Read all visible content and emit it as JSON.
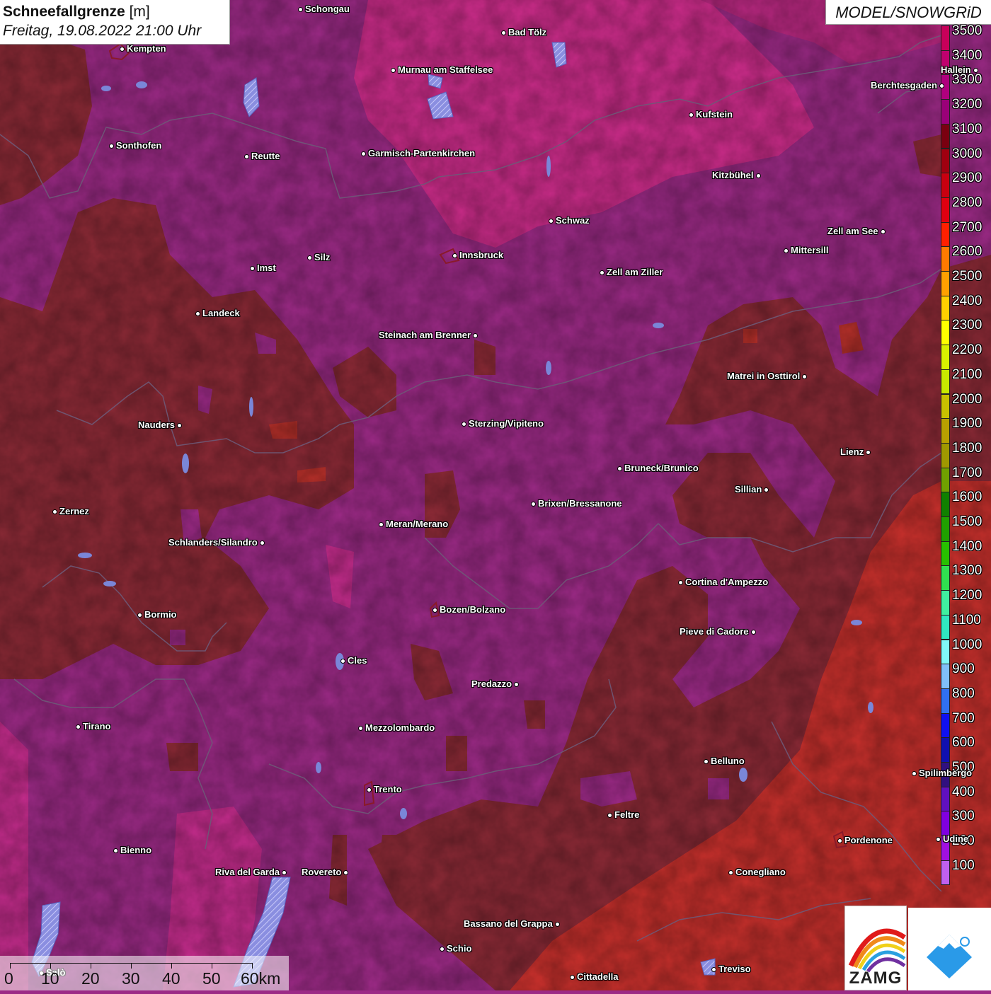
{
  "header": {
    "title": "Schneefallgrenze",
    "unit": "[m]",
    "datetime": "Freitag, 19.08.2022 21:00 Uhr"
  },
  "model_label": "MODEL/SNOWGRiD",
  "colors": {
    "background_magenta": "#9c2a86",
    "high_pink": "#cc2c8a",
    "dark_red": "#8c2a36",
    "red": "#c8302c",
    "hatch_lake": "#7a86d8",
    "border_line": "#6a5a7a"
  },
  "legend": {
    "levels": [
      {
        "label": "3500",
        "color": "#c8005a"
      },
      {
        "label": "3400",
        "color": "#c0006e"
      },
      {
        "label": "3300",
        "color": "#b0007e"
      },
      {
        "label": "3200",
        "color": "#9a0078"
      },
      {
        "label": "3100",
        "color": "#7a0010"
      },
      {
        "label": "3000",
        "color": "#a00010"
      },
      {
        "label": "2900",
        "color": "#c80010"
      },
      {
        "label": "2800",
        "color": "#e00010"
      },
      {
        "label": "2700",
        "color": "#ff2000"
      },
      {
        "label": "2600",
        "color": "#ff7a00"
      },
      {
        "label": "2500",
        "color": "#ffa000"
      },
      {
        "label": "2400",
        "color": "#ffd000"
      },
      {
        "label": "2300",
        "color": "#ffff00"
      },
      {
        "label": "2200",
        "color": "#d8f000"
      },
      {
        "label": "2100",
        "color": "#c8e800"
      },
      {
        "label": "2000",
        "color": "#c8c000"
      },
      {
        "label": "1900",
        "color": "#b8a000"
      },
      {
        "label": "1800",
        "color": "#a09800"
      },
      {
        "label": "1700",
        "color": "#70a000"
      },
      {
        "label": "1600",
        "color": "#108000"
      },
      {
        "label": "1500",
        "color": "#20a000"
      },
      {
        "label": "1400",
        "color": "#28c000"
      },
      {
        "label": "1300",
        "color": "#30e050"
      },
      {
        "label": "1200",
        "color": "#40f0a0"
      },
      {
        "label": "1100",
        "color": "#30e8c0"
      },
      {
        "label": "1000",
        "color": "#80f8f8"
      },
      {
        "label": "900",
        "color": "#80c0f8"
      },
      {
        "label": "800",
        "color": "#3070f0"
      },
      {
        "label": "700",
        "color": "#1010f0"
      },
      {
        "label": "600",
        "color": "#1010b0"
      },
      {
        "label": "500",
        "color": "#301080"
      },
      {
        "label": "400",
        "color": "#6010c0"
      },
      {
        "label": "300",
        "color": "#8000e0"
      },
      {
        "label": "200",
        "color": "#a010e0"
      },
      {
        "label": "100",
        "color": "#c060f0"
      }
    ]
  },
  "cities": [
    {
      "name": "Schongau",
      "side": "right"
    },
    {
      "name": "Bad Tölz",
      "side": "right"
    },
    {
      "name": "Kempten",
      "side": "right"
    },
    {
      "name": "Murnau am Staffelsee",
      "side": "right"
    },
    {
      "name": "Hallein",
      "side": "left"
    },
    {
      "name": "Berchtesgaden",
      "side": "left"
    },
    {
      "name": "Kufstein",
      "side": "right"
    },
    {
      "name": "Sonthofen",
      "side": "right"
    },
    {
      "name": "Reutte",
      "side": "right"
    },
    {
      "name": "Garmisch-Partenkirchen",
      "side": "right"
    },
    {
      "name": "Kitzbühel",
      "side": "left"
    },
    {
      "name": "Schwaz",
      "side": "right"
    },
    {
      "name": "Zell am See",
      "side": "left"
    },
    {
      "name": "Innsbruck",
      "side": "right"
    },
    {
      "name": "Mittersill",
      "side": "right"
    },
    {
      "name": "Imst",
      "side": "right"
    },
    {
      "name": "Silz",
      "side": "right"
    },
    {
      "name": "Zell am Ziller",
      "side": "right"
    },
    {
      "name": "Landeck",
      "side": "right"
    },
    {
      "name": "Steinach am Brenner",
      "side": "left"
    },
    {
      "name": "Matrei in Osttirol",
      "side": "left"
    },
    {
      "name": "Nauders",
      "side": "left"
    },
    {
      "name": "Sterzing/Vipiteno",
      "side": "right"
    },
    {
      "name": "Lienz",
      "side": "left"
    },
    {
      "name": "Bruneck/Brunico",
      "side": "right"
    },
    {
      "name": "Sillian",
      "side": "left"
    },
    {
      "name": "Zernez",
      "side": "right"
    },
    {
      "name": "Brixen/Bressanone",
      "side": "right"
    },
    {
      "name": "Meran/Merano",
      "side": "right"
    },
    {
      "name": "Schlanders/Silandro",
      "side": "left"
    },
    {
      "name": "Cortina d'Ampezzo",
      "side": "right"
    },
    {
      "name": "Bozen/Bolzano",
      "side": "right"
    },
    {
      "name": "Bormio",
      "side": "right"
    },
    {
      "name": "Pieve di Cadore",
      "side": "left"
    },
    {
      "name": "Cles",
      "side": "right"
    },
    {
      "name": "Predazzo",
      "side": "left"
    },
    {
      "name": "Tirano",
      "side": "right"
    },
    {
      "name": "Mezzolombardo",
      "side": "right"
    },
    {
      "name": "Belluno",
      "side": "right"
    },
    {
      "name": "Spilimbergo",
      "side": "right"
    },
    {
      "name": "Trento",
      "side": "right"
    },
    {
      "name": "Feltre",
      "side": "right"
    },
    {
      "name": "Pordenone",
      "side": "right"
    },
    {
      "name": "Udine",
      "side": "right"
    },
    {
      "name": "Bienno",
      "side": "right"
    },
    {
      "name": "Riva del Garda",
      "side": "left"
    },
    {
      "name": "Rovereto",
      "side": "left"
    },
    {
      "name": "Conegliano",
      "side": "right"
    },
    {
      "name": "Bassano del Grappa",
      "side": "left"
    },
    {
      "name": "Schio",
      "side": "right"
    },
    {
      "name": "Treviso",
      "side": "right"
    },
    {
      "name": "Salò",
      "side": "right"
    },
    {
      "name": "Cittadella",
      "side": "right"
    }
  ],
  "scale": {
    "labels": [
      "0",
      "10",
      "20",
      "30",
      "40",
      "50",
      "60km"
    ]
  },
  "logos": {
    "zamg": "ZAMG",
    "snow": "snow-mountain-icon"
  }
}
